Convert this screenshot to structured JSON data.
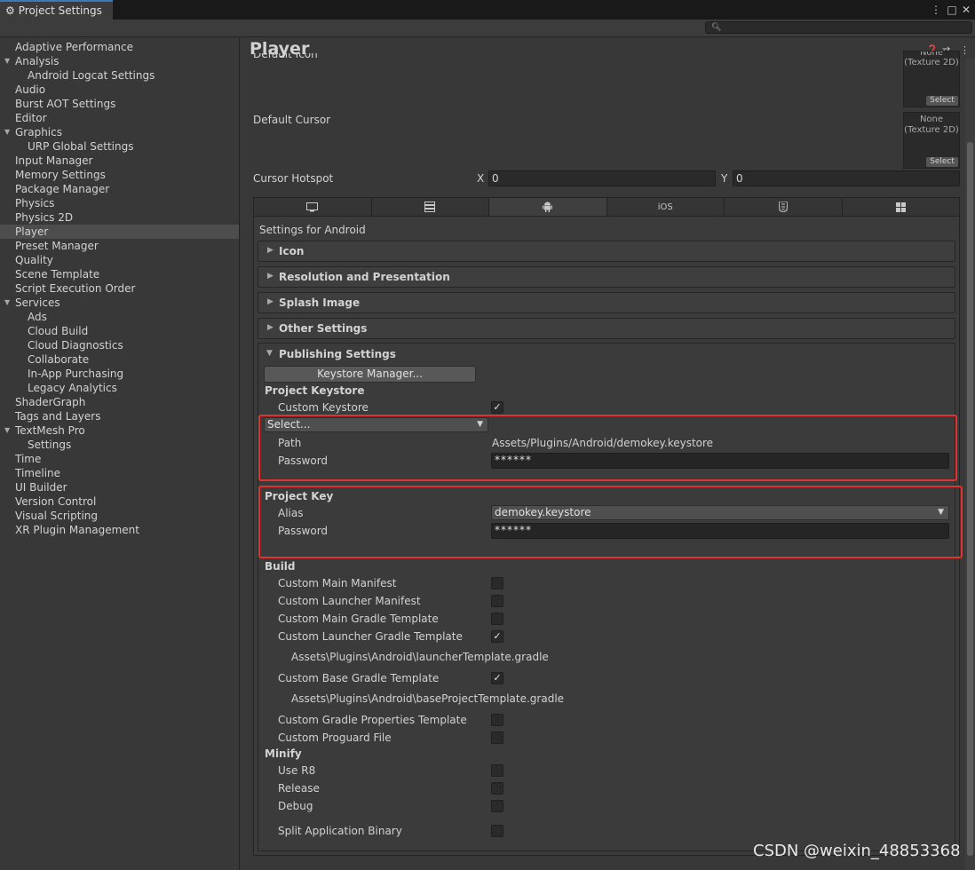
{
  "window": {
    "tab_title": "Project Settings",
    "tab_icon": "gear-icon"
  },
  "search": {
    "placeholder": ""
  },
  "sidebar": {
    "items": [
      {
        "label": "Adaptive Performance",
        "indent": 0
      },
      {
        "label": "Analysis",
        "indent": 0,
        "expanded": true
      },
      {
        "label": "Android Logcat Settings",
        "indent": 1
      },
      {
        "label": "Audio",
        "indent": 0
      },
      {
        "label": "Burst AOT Settings",
        "indent": 0
      },
      {
        "label": "Editor",
        "indent": 0
      },
      {
        "label": "Graphics",
        "indent": 0,
        "expanded": true
      },
      {
        "label": "URP Global Settings",
        "indent": 1
      },
      {
        "label": "Input Manager",
        "indent": 0
      },
      {
        "label": "Memory Settings",
        "indent": 0
      },
      {
        "label": "Package Manager",
        "indent": 0
      },
      {
        "label": "Physics",
        "indent": 0
      },
      {
        "label": "Physics 2D",
        "indent": 0
      },
      {
        "label": "Player",
        "indent": 0,
        "selected": true
      },
      {
        "label": "Preset Manager",
        "indent": 0
      },
      {
        "label": "Quality",
        "indent": 0
      },
      {
        "label": "Scene Template",
        "indent": 0
      },
      {
        "label": "Script Execution Order",
        "indent": 0
      },
      {
        "label": "Services",
        "indent": 0,
        "expanded": true
      },
      {
        "label": "Ads",
        "indent": 1
      },
      {
        "label": "Cloud Build",
        "indent": 1
      },
      {
        "label": "Cloud Diagnostics",
        "indent": 1
      },
      {
        "label": "Collaborate",
        "indent": 1
      },
      {
        "label": "In-App Purchasing",
        "indent": 1
      },
      {
        "label": "Legacy Analytics",
        "indent": 1
      },
      {
        "label": "ShaderGraph",
        "indent": 0
      },
      {
        "label": "Tags and Layers",
        "indent": 0
      },
      {
        "label": "TextMesh Pro",
        "indent": 0,
        "expanded": true
      },
      {
        "label": "Settings",
        "indent": 1
      },
      {
        "label": "Time",
        "indent": 0
      },
      {
        "label": "Timeline",
        "indent": 0
      },
      {
        "label": "UI Builder",
        "indent": 0
      },
      {
        "label": "Version Control",
        "indent": 0
      },
      {
        "label": "Visual Scripting",
        "indent": 0
      },
      {
        "label": "XR Plugin Management",
        "indent": 0
      }
    ]
  },
  "player": {
    "title": "Player",
    "default_icon_label": "Default Icon",
    "default_icon_value": "None\n(Texture 2D)",
    "default_cursor_label": "Default Cursor",
    "default_cursor_value": "None\n(Texture 2D)",
    "select_label": "Select",
    "cursor_hotspot_label": "Cursor Hotspot",
    "x_label": "X",
    "x_value": "0",
    "y_label": "Y",
    "y_value": "0"
  },
  "platform_tabs": [
    {
      "icon": "monitor-icon"
    },
    {
      "icon": "server-icon"
    },
    {
      "icon": "android-icon",
      "active": true
    },
    {
      "label": "iOS"
    },
    {
      "icon": "html5-icon"
    },
    {
      "icon": "windows-icon"
    }
  ],
  "android": {
    "settings_label": "Settings for Android",
    "sections": [
      "Icon",
      "Resolution and Presentation",
      "Splash Image",
      "Other Settings"
    ],
    "publishing": {
      "title": "Publishing Settings",
      "keystore_manager": "Keystore Manager...",
      "project_keystore": "Project Keystore",
      "custom_keystore": "Custom Keystore",
      "custom_keystore_checked": true,
      "keystore_select": "Select...",
      "path_label": "Path",
      "path_value": "Assets/Plugins/Android/demokey.keystore",
      "password_label": "Password",
      "password_value": "******",
      "project_key": "Project Key",
      "alias_label": "Alias",
      "alias_value": "demokey.keystore",
      "key_password_label": "Password",
      "key_password_value": "******",
      "build_label": "Build",
      "build_items": [
        {
          "label": "Custom Main Manifest",
          "checked": false
        },
        {
          "label": "Custom Launcher Manifest",
          "checked": false
        },
        {
          "label": "Custom Main Gradle Template",
          "checked": false
        },
        {
          "label": "Custom Launcher Gradle Template",
          "checked": true,
          "path": "Assets\\Plugins\\Android\\launcherTemplate.gradle"
        },
        {
          "label": "Custom Base Gradle Template",
          "checked": true,
          "path": "Assets\\Plugins\\Android\\baseProjectTemplate.gradle"
        },
        {
          "label": "Custom Gradle Properties Template",
          "checked": false
        },
        {
          "label": "Custom Proguard File",
          "checked": false
        }
      ],
      "minify_label": "Minify",
      "minify_items": [
        {
          "label": "Use R8",
          "checked": false
        },
        {
          "label": "Release",
          "checked": false
        },
        {
          "label": "Debug",
          "checked": false
        }
      ],
      "split_binary_label": "Split Application Binary",
      "split_binary_checked": false
    }
  },
  "watermark": "CSDN @weixin_48853368",
  "colors": {
    "highlight": "#e0332e",
    "selected_bg": "#4d4d4d",
    "tab_accent": "#3a79bb"
  }
}
